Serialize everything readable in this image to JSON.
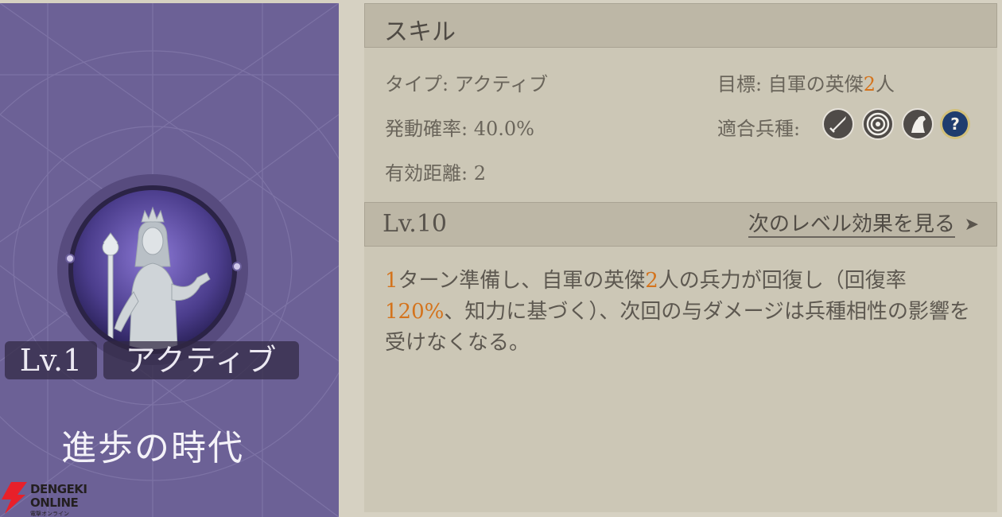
{
  "skill_card": {
    "level": "Lv.1",
    "type": "アクティブ",
    "name": "進歩の時代"
  },
  "watermark": {
    "brand_line1": "DENGEKI",
    "brand_line2": "ONLINE",
    "brand_sub": "電撃オンライン"
  },
  "skill_section": {
    "title": "スキル",
    "type_label": "タイプ: ",
    "type_value": "アクティブ",
    "rate_label": "発動確率: ",
    "rate_value": "40.0%",
    "range_label": "有効距離: ",
    "range_value": "2",
    "target_label": "目標: ",
    "target_prefix": "自軍の英傑",
    "target_count": "2",
    "target_suffix": "人",
    "troops_label": "適合兵種: ",
    "troop_icons": [
      "sword-icon",
      "target-icon",
      "horse-icon",
      "question-icon"
    ]
  },
  "level_section": {
    "title": "Lv.10",
    "next_link": "次のレベル効果を見る",
    "arrow": "➤"
  },
  "description": {
    "p1": "1",
    "p2": "ターン準備し、自軍の英傑",
    "p3": "2",
    "p4": "人の兵力が回復し（回復率",
    "p5": "120%",
    "p6": "、知力に基づく）、次回の与ダメージは兵種相性の影響を受けなくなる。"
  },
  "colors": {
    "accent_orange": "#d4731c",
    "card_purple": "#6c6196",
    "panel_beige": "#ccc7b6"
  }
}
